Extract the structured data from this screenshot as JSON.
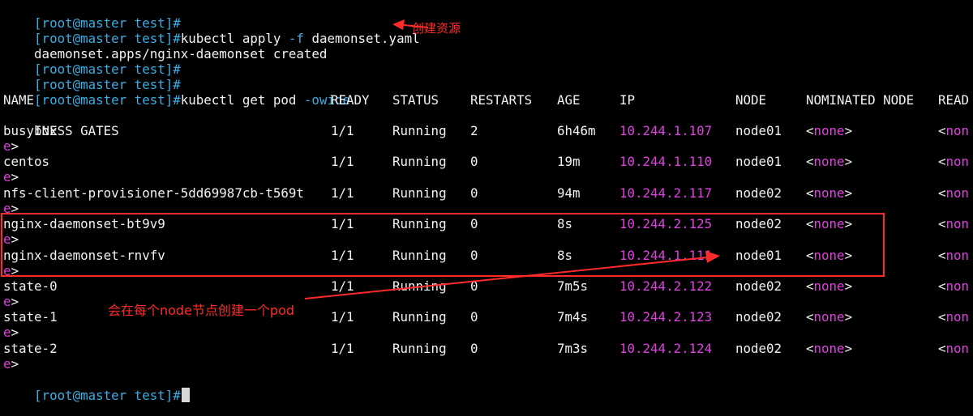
{
  "prompt": "[root@master test]#",
  "commands": {
    "apply": {
      "text": "kubectl apply ",
      "flag": "-f",
      "rest": " daemonset.yaml"
    },
    "get": {
      "text": "kubectl get pod ",
      "flag": "-owide"
    }
  },
  "apply_output": "daemonset.apps/nginx-daemonset created",
  "headers": {
    "name": "NAME",
    "ready": "READY",
    "status": "STATUS",
    "restarts": "RESTARTS",
    "age": "AGE",
    "ip": "IP",
    "node": "NODE",
    "nominated": "NOMINATED NODE",
    "readiness_start": "READ",
    "readiness_wrap": "INESS GATES"
  },
  "pods": [
    {
      "name": "busybox",
      "ready": "1/1",
      "status": "Running",
      "restarts": "2",
      "age": "6h46m",
      "ip": "10.244.1.107",
      "node": "node01",
      "nominated": "<none>",
      "readiness": "<non",
      "wrap": "e>"
    },
    {
      "name": "centos",
      "ready": "1/1",
      "status": "Running",
      "restarts": "0",
      "age": "19m",
      "ip": "10.244.1.110",
      "node": "node01",
      "nominated": "<none>",
      "readiness": "<non",
      "wrap": "e>"
    },
    {
      "name": "nfs-client-provisioner-5dd69987cb-t569t",
      "ready": "1/1",
      "status": "Running",
      "restarts": "0",
      "age": "94m",
      "ip": "10.244.2.117",
      "node": "node02",
      "nominated": "<none>",
      "readiness": "<non",
      "wrap": "e>"
    },
    {
      "name": "nginx-daemonset-bt9v9",
      "ready": "1/1",
      "status": "Running",
      "restarts": "0",
      "age": "8s",
      "ip": "10.244.2.125",
      "node": "node02",
      "nominated": "<none>",
      "readiness": "<non",
      "wrap": "e>"
    },
    {
      "name": "nginx-daemonset-rnvfv",
      "ready": "1/1",
      "status": "Running",
      "restarts": "0",
      "age": "8s",
      "ip": "10.244.1.111",
      "node": "node01",
      "nominated": "<none>",
      "readiness": "<non",
      "wrap": "e>"
    },
    {
      "name": "state-0",
      "ready": "1/1",
      "status": "Running",
      "restarts": "0",
      "age": "7m5s",
      "ip": "10.244.2.122",
      "node": "node02",
      "nominated": "<none>",
      "readiness": "<non",
      "wrap": "e>"
    },
    {
      "name": "state-1",
      "ready": "1/1",
      "status": "Running",
      "restarts": "0",
      "age": "7m4s",
      "ip": "10.244.2.123",
      "node": "node02",
      "nominated": "<none>",
      "readiness": "<non",
      "wrap": "e>"
    },
    {
      "name": "state-2",
      "ready": "1/1",
      "status": "Running",
      "restarts": "0",
      "age": "7m3s",
      "ip": "10.244.2.124",
      "node": "node02",
      "nominated": "<none>",
      "readiness": "<non",
      "wrap": "e>"
    }
  ],
  "annotations": {
    "create_resource": "创建资源",
    "per_node": "会在每个node节点创建一个pod"
  },
  "colors": {
    "background": "#000000",
    "text": "#f2f2f2",
    "prompt": "#3aaee6",
    "ip": "#e040e0",
    "annotation": "#ff2a2a"
  }
}
